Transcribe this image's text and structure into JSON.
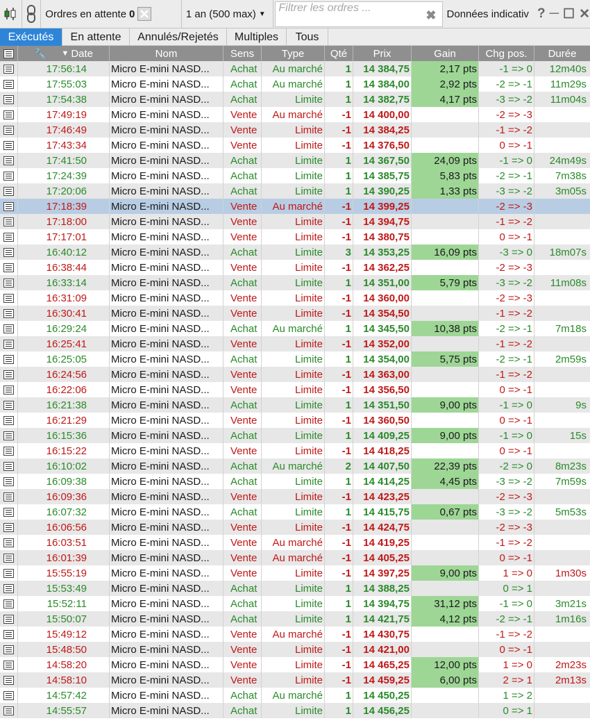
{
  "toolbar": {
    "pending_label": "Ordres en attente",
    "pending_count": "0",
    "period": "1 an (500 max)",
    "filter_placeholder": "Filtrer les ordres ...",
    "info_label": "Données indicativ",
    "help": "?",
    "icons": [
      "chart-candle-icon",
      "link-icon",
      "clear-icon",
      "dropdown-icon",
      "close-icon",
      "minimize-icon",
      "maximize-icon"
    ]
  },
  "tabs": [
    "Exécutés",
    "En attente",
    "Annulés/Rejetés",
    "Multiples",
    "Tous"
  ],
  "active_tab": "Exécutés",
  "columns": [
    "Date",
    "Nom",
    "Sens",
    "Type",
    "Qté",
    "Prix",
    "Gain",
    "Chg pos.",
    "Durée"
  ],
  "sort_column": "Date",
  "colors": {
    "buy": "#2a8a2a",
    "sell": "#c01818",
    "gain_bg": "#9ed696",
    "tab_active": "#2e85d8",
    "header": "#8f8f8f",
    "selected_row": "#b8cde3"
  },
  "rows": [
    {
      "date": "17:56:14",
      "nom": "Micro E-mini NASD...",
      "sens": "Achat",
      "type": "Au marché",
      "qte": "1",
      "prix": "14 384,75",
      "gain": "2,17 pts",
      "chg": "-1 => 0",
      "duree": "12m40s"
    },
    {
      "date": "17:55:03",
      "nom": "Micro E-mini NASD...",
      "sens": "Achat",
      "type": "Au marché",
      "qte": "1",
      "prix": "14 384,00",
      "gain": "2,92 pts",
      "chg": "-2 => -1",
      "duree": "11m29s"
    },
    {
      "date": "17:54:38",
      "nom": "Micro E-mini NASD...",
      "sens": "Achat",
      "type": "Limite",
      "qte": "1",
      "prix": "14 382,75",
      "gain": "4,17 pts",
      "chg": "-3 => -2",
      "duree": "11m04s"
    },
    {
      "date": "17:49:19",
      "nom": "Micro E-mini NASD...",
      "sens": "Vente",
      "type": "Au marché",
      "qte": "-1",
      "prix": "14 400,00",
      "gain": "",
      "chg": "-2 => -3",
      "duree": ""
    },
    {
      "date": "17:46:49",
      "nom": "Micro E-mini NASD...",
      "sens": "Vente",
      "type": "Limite",
      "qte": "-1",
      "prix": "14 384,25",
      "gain": "",
      "chg": "-1 => -2",
      "duree": ""
    },
    {
      "date": "17:43:34",
      "nom": "Micro E-mini NASD...",
      "sens": "Vente",
      "type": "Limite",
      "qte": "-1",
      "prix": "14 376,50",
      "gain": "",
      "chg": "0 => -1",
      "duree": ""
    },
    {
      "date": "17:41:50",
      "nom": "Micro E-mini NASD...",
      "sens": "Achat",
      "type": "Limite",
      "qte": "1",
      "prix": "14 367,50",
      "gain": "24,09 pts",
      "chg": "-1 => 0",
      "duree": "24m49s"
    },
    {
      "date": "17:24:39",
      "nom": "Micro E-mini NASD...",
      "sens": "Achat",
      "type": "Limite",
      "qte": "1",
      "prix": "14 385,75",
      "gain": "5,83 pts",
      "chg": "-2 => -1",
      "duree": "7m38s"
    },
    {
      "date": "17:20:06",
      "nom": "Micro E-mini NASD...",
      "sens": "Achat",
      "type": "Limite",
      "qte": "1",
      "prix": "14 390,25",
      "gain": "1,33 pts",
      "chg": "-3 => -2",
      "duree": "3m05s"
    },
    {
      "date": "17:18:39",
      "nom": "Micro E-mini NASD...",
      "sens": "Vente",
      "type": "Au marché",
      "qte": "-1",
      "prix": "14 399,25",
      "gain": "",
      "chg": "-2 => -3",
      "duree": "",
      "selected": true
    },
    {
      "date": "17:18:00",
      "nom": "Micro E-mini NASD...",
      "sens": "Vente",
      "type": "Limite",
      "qte": "-1",
      "prix": "14 394,75",
      "gain": "",
      "chg": "-1 => -2",
      "duree": ""
    },
    {
      "date": "17:17:01",
      "nom": "Micro E-mini NASD...",
      "sens": "Vente",
      "type": "Limite",
      "qte": "-1",
      "prix": "14 380,75",
      "gain": "",
      "chg": "0 => -1",
      "duree": ""
    },
    {
      "date": "16:40:12",
      "nom": "Micro E-mini NASD...",
      "sens": "Achat",
      "type": "Limite",
      "qte": "3",
      "prix": "14 353,25",
      "gain": "16,09 pts",
      "chg": "-3 => 0",
      "duree": "18m07s"
    },
    {
      "date": "16:38:44",
      "nom": "Micro E-mini NASD...",
      "sens": "Vente",
      "type": "Limite",
      "qte": "-1",
      "prix": "14 362,25",
      "gain": "",
      "chg": "-2 => -3",
      "duree": ""
    },
    {
      "date": "16:33:14",
      "nom": "Micro E-mini NASD...",
      "sens": "Achat",
      "type": "Limite",
      "qte": "1",
      "prix": "14 351,00",
      "gain": "5,79 pts",
      "chg": "-3 => -2",
      "duree": "11m08s"
    },
    {
      "date": "16:31:09",
      "nom": "Micro E-mini NASD...",
      "sens": "Vente",
      "type": "Limite",
      "qte": "-1",
      "prix": "14 360,00",
      "gain": "",
      "chg": "-2 => -3",
      "duree": ""
    },
    {
      "date": "16:30:41",
      "nom": "Micro E-mini NASD...",
      "sens": "Vente",
      "type": "Limite",
      "qte": "-1",
      "prix": "14 354,50",
      "gain": "",
      "chg": "-1 => -2",
      "duree": ""
    },
    {
      "date": "16:29:24",
      "nom": "Micro E-mini NASD...",
      "sens": "Achat",
      "type": "Au marché",
      "qte": "1",
      "prix": "14 345,50",
      "gain": "10,38 pts",
      "chg": "-2 => -1",
      "duree": "7m18s"
    },
    {
      "date": "16:25:41",
      "nom": "Micro E-mini NASD...",
      "sens": "Vente",
      "type": "Limite",
      "qte": "-1",
      "prix": "14 352,00",
      "gain": "",
      "chg": "-1 => -2",
      "duree": ""
    },
    {
      "date": "16:25:05",
      "nom": "Micro E-mini NASD...",
      "sens": "Achat",
      "type": "Limite",
      "qte": "1",
      "prix": "14 354,00",
      "gain": "5,75 pts",
      "chg": "-2 => -1",
      "duree": "2m59s"
    },
    {
      "date": "16:24:56",
      "nom": "Micro E-mini NASD...",
      "sens": "Vente",
      "type": "Limite",
      "qte": "-1",
      "prix": "14 363,00",
      "gain": "",
      "chg": "-1 => -2",
      "duree": ""
    },
    {
      "date": "16:22:06",
      "nom": "Micro E-mini NASD...",
      "sens": "Vente",
      "type": "Limite",
      "qte": "-1",
      "prix": "14 356,50",
      "gain": "",
      "chg": "0 => -1",
      "duree": ""
    },
    {
      "date": "16:21:38",
      "nom": "Micro E-mini NASD...",
      "sens": "Achat",
      "type": "Limite",
      "qte": "1",
      "prix": "14 351,50",
      "gain": "9,00 pts",
      "chg": "-1 => 0",
      "duree": "9s"
    },
    {
      "date": "16:21:29",
      "nom": "Micro E-mini NASD...",
      "sens": "Vente",
      "type": "Limite",
      "qte": "-1",
      "prix": "14 360,50",
      "gain": "",
      "chg": "0 => -1",
      "duree": ""
    },
    {
      "date": "16:15:36",
      "nom": "Micro E-mini NASD...",
      "sens": "Achat",
      "type": "Limite",
      "qte": "1",
      "prix": "14 409,25",
      "gain": "9,00 pts",
      "chg": "-1 => 0",
      "duree": "15s"
    },
    {
      "date": "16:15:22",
      "nom": "Micro E-mini NASD...",
      "sens": "Vente",
      "type": "Limite",
      "qte": "-1",
      "prix": "14 418,25",
      "gain": "",
      "chg": "0 => -1",
      "duree": ""
    },
    {
      "date": "16:10:02",
      "nom": "Micro E-mini NASD...",
      "sens": "Achat",
      "type": "Au marché",
      "qte": "2",
      "prix": "14 407,50",
      "gain": "22,39 pts",
      "chg": "-2 => 0",
      "duree": "8m23s"
    },
    {
      "date": "16:09:38",
      "nom": "Micro E-mini NASD...",
      "sens": "Achat",
      "type": "Limite",
      "qte": "1",
      "prix": "14 414,25",
      "gain": "4,45 pts",
      "chg": "-3 => -2",
      "duree": "7m59s"
    },
    {
      "date": "16:09:36",
      "nom": "Micro E-mini NASD...",
      "sens": "Vente",
      "type": "Limite",
      "qte": "-1",
      "prix": "14 423,25",
      "gain": "",
      "chg": "-2 => -3",
      "duree": ""
    },
    {
      "date": "16:07:32",
      "nom": "Micro E-mini NASD...",
      "sens": "Achat",
      "type": "Limite",
      "qte": "1",
      "prix": "14 415,75",
      "gain": "0,67 pts",
      "chg": "-3 => -2",
      "duree": "5m53s"
    },
    {
      "date": "16:06:56",
      "nom": "Micro E-mini NASD...",
      "sens": "Vente",
      "type": "Limite",
      "qte": "-1",
      "prix": "14 424,75",
      "gain": "",
      "chg": "-2 => -3",
      "duree": ""
    },
    {
      "date": "16:03:51",
      "nom": "Micro E-mini NASD...",
      "sens": "Vente",
      "type": "Au marché",
      "qte": "-1",
      "prix": "14 419,25",
      "gain": "",
      "chg": "-1 => -2",
      "duree": ""
    },
    {
      "date": "16:01:39",
      "nom": "Micro E-mini NASD...",
      "sens": "Vente",
      "type": "Au marché",
      "qte": "-1",
      "prix": "14 405,25",
      "gain": "",
      "chg": "0 => -1",
      "duree": ""
    },
    {
      "date": "15:55:19",
      "nom": "Micro E-mini NASD...",
      "sens": "Vente",
      "type": "Limite",
      "qte": "-1",
      "prix": "14 397,25",
      "gain": "9,00 pts",
      "chg": "1 => 0",
      "duree": "1m30s"
    },
    {
      "date": "15:53:49",
      "nom": "Micro E-mini NASD...",
      "sens": "Achat",
      "type": "Limite",
      "qte": "1",
      "prix": "14 388,25",
      "gain": "",
      "chg": "0 => 1",
      "duree": ""
    },
    {
      "date": "15:52:11",
      "nom": "Micro E-mini NASD...",
      "sens": "Achat",
      "type": "Limite",
      "qte": "1",
      "prix": "14 394,75",
      "gain": "31,12 pts",
      "chg": "-1 => 0",
      "duree": "3m21s"
    },
    {
      "date": "15:50:07",
      "nom": "Micro E-mini NASD...",
      "sens": "Achat",
      "type": "Limite",
      "qte": "1",
      "prix": "14 421,75",
      "gain": "4,12 pts",
      "chg": "-2 => -1",
      "duree": "1m16s"
    },
    {
      "date": "15:49:12",
      "nom": "Micro E-mini NASD...",
      "sens": "Vente",
      "type": "Au marché",
      "qte": "-1",
      "prix": "14 430,75",
      "gain": "",
      "chg": "-1 => -2",
      "duree": ""
    },
    {
      "date": "15:48:50",
      "nom": "Micro E-mini NASD...",
      "sens": "Vente",
      "type": "Limite",
      "qte": "-1",
      "prix": "14 421,00",
      "gain": "",
      "chg": "0 => -1",
      "duree": ""
    },
    {
      "date": "14:58:20",
      "nom": "Micro E-mini NASD...",
      "sens": "Vente",
      "type": "Limite",
      "qte": "-1",
      "prix": "14 465,25",
      "gain": "12,00 pts",
      "chg": "1 => 0",
      "duree": "2m23s"
    },
    {
      "date": "14:58:10",
      "nom": "Micro E-mini NASD...",
      "sens": "Vente",
      "type": "Limite",
      "qte": "-1",
      "prix": "14 459,25",
      "gain": "6,00 pts",
      "chg": "2 => 1",
      "duree": "2m13s"
    },
    {
      "date": "14:57:42",
      "nom": "Micro E-mini NASD...",
      "sens": "Achat",
      "type": "Au marché",
      "qte": "1",
      "prix": "14 450,25",
      "gain": "",
      "chg": "1 => 2",
      "duree": ""
    },
    {
      "date": "14:55:57",
      "nom": "Micro E-mini NASD...",
      "sens": "Achat",
      "type": "Limite",
      "qte": "1",
      "prix": "14 456,25",
      "gain": "",
      "chg": "0 => 1",
      "duree": ""
    }
  ]
}
